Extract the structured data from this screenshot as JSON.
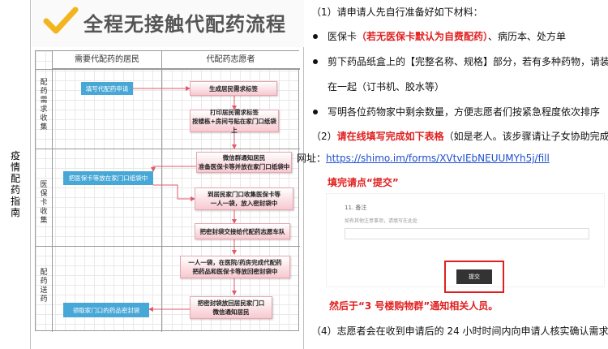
{
  "side_label": "疫情配药指南",
  "flowchart": {
    "title": "全程无接触代配药流程",
    "columns": [
      "需要代配药的居民",
      "代配药志愿者"
    ],
    "lanes": [
      "配药需求收集",
      "医保卡收集",
      "配药送药"
    ],
    "steps": [
      "填写代配药申请",
      "生成居民需求标签",
      "打印居民需求标签\n按楼栋+房间号贴在家门口纸袋上",
      "微信群通知居民\n准备医保卡等并放在家门口纸袋中",
      "把医保卡等放在家门口纸袋中",
      "到居民家门口收集医保卡等\n一人一袋，放入密封袋中",
      "把密封袋交接给代配药志愿车队",
      "一人一袋，在医院/药房完成代配药\n把药品和医保卡等放回密封袋中",
      "把密封袋放回居民家门口\n微信通知居民",
      "领取家门口的药品密封袋"
    ],
    "colors": {
      "blue": "#47a7d6",
      "pink": "#f7c8cf",
      "check": "#f3b51f"
    }
  },
  "instructions": {
    "step1": "（1）请申请人先自行准备好如下材料：",
    "bullet1_a": "医保卡",
    "bullet1_red": "（若无医保卡默认为自费配药）",
    "bullet1_b": "、病历本、处方单",
    "bullet2_line1": "剪下药品纸盒上的【完整名称、规格】部分，若有多种药物，请装订",
    "bullet2_line2": "在一起（订书机、胶水等）",
    "bullet3": "写明各位药物家中剩余数量，方便志愿者们按紧急程度依次排序",
    "step2_a": "（2）",
    "step2_red": "请在线填写完成如下表格",
    "step2_b": "（如是老人。该步骤请让子女协助完成）：",
    "url_label": "网址：",
    "url": "https://shimo.im/forms/XVtvIEbNEUUMYh5j/fill",
    "submit_hint": "填完请点“提交”",
    "form_label": "11. 备注",
    "form_placeholder": "如有其他注意事项，请填写在此处",
    "submit_button": "提交",
    "notice": "然后于“3 号楼购物群”通知相关人员。",
    "step4": "（4）志愿者会在收到申请后的 24 小时时间内向申请人核实确认需求。"
  }
}
